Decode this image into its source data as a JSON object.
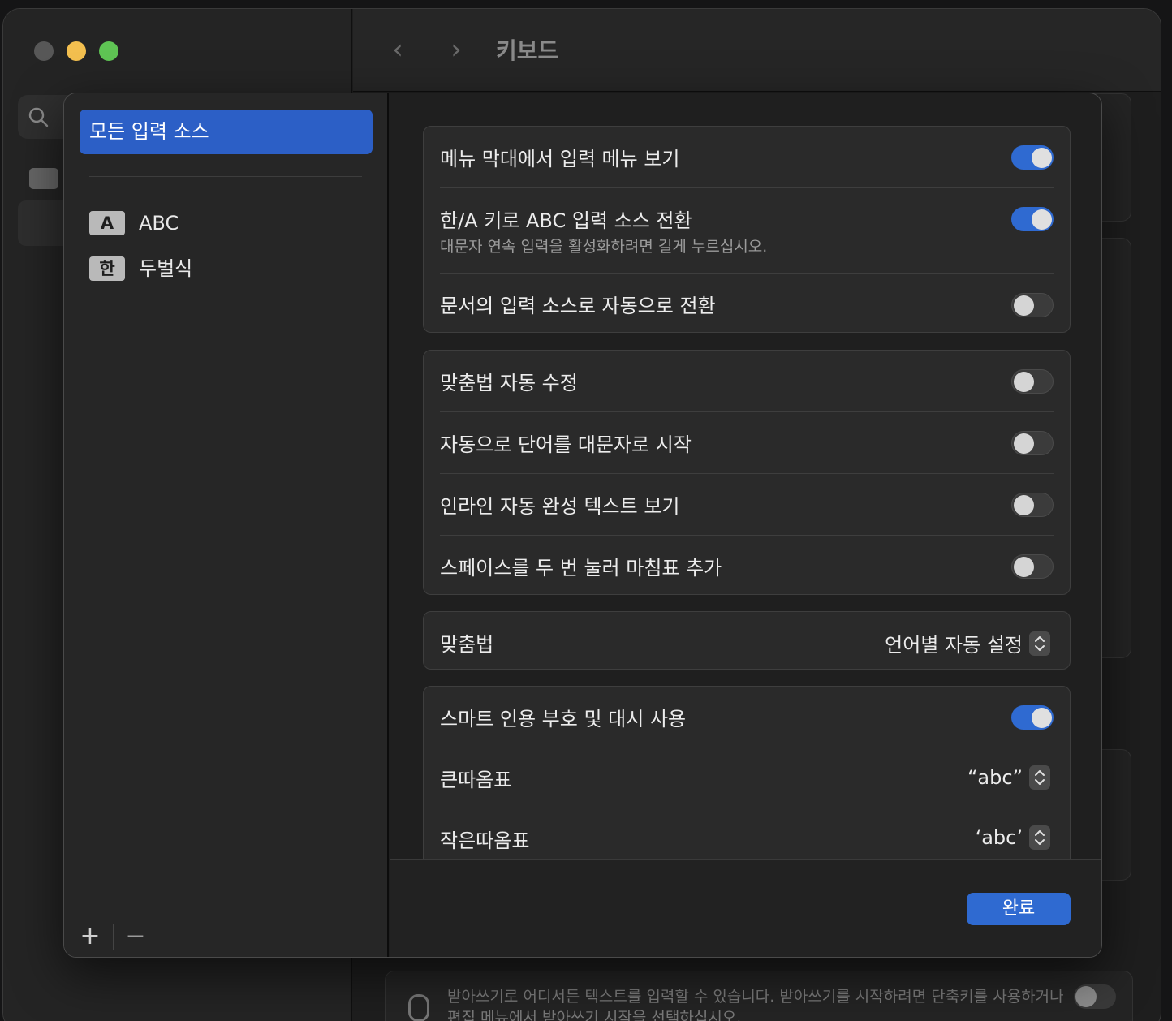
{
  "window": {
    "title": "키보드",
    "nav_back": "‹",
    "nav_forward": "›"
  },
  "dictation": {
    "text": "받아쓰기로 어디서든 텍스트를 입력할 수 있습니다. 받아쓰기를 시작하려면 단축키를 사용하거나 편집 메뉴에서 받아쓰기 시작을 선택하십시오.",
    "enabled": false
  },
  "sidebar": {
    "all_sources_label": "모든 입력 소스",
    "sources": [
      {
        "badge": "A",
        "label": "ABC"
      },
      {
        "badge": "한",
        "label": "두벌식"
      }
    ],
    "add_label": "+",
    "remove_label": "−"
  },
  "groups": [
    {
      "rows": [
        {
          "label": "메뉴 막대에서 입력 메뉴 보기",
          "type": "toggle",
          "on": true
        },
        {
          "label": "한/A 키로 ABC 입력 소스 전환",
          "sub": "대문자 연속 입력을 활성화하려면 길게 누르십시오.",
          "type": "toggle",
          "on": true
        },
        {
          "label": "문서의 입력 소스로 자동으로 전환",
          "type": "toggle",
          "on": false
        }
      ]
    },
    {
      "rows": [
        {
          "label": "맞춤법 자동 수정",
          "type": "toggle",
          "on": false
        },
        {
          "label": "자동으로 단어를 대문자로 시작",
          "type": "toggle",
          "on": false
        },
        {
          "label": "인라인 자동 완성 텍스트 보기",
          "type": "toggle",
          "on": false
        },
        {
          "label": "스페이스를 두 번 눌러 마침표 추가",
          "type": "toggle",
          "on": false
        }
      ]
    },
    {
      "rows": [
        {
          "label": "맞춤법",
          "type": "popup",
          "value": "언어별 자동 설정"
        }
      ]
    },
    {
      "rows": [
        {
          "label": "스마트 인용 부호 및 대시 사용",
          "type": "toggle",
          "on": true
        },
        {
          "label": "큰따옴표",
          "type": "popup",
          "value": "“abc”"
        },
        {
          "label": "작은따옴표",
          "type": "popup",
          "value": "‘abc’"
        }
      ]
    }
  ],
  "footer": {
    "done_label": "완료"
  },
  "colors": {
    "accent": "#2f6ad1",
    "selection": "#2c5fc6"
  }
}
